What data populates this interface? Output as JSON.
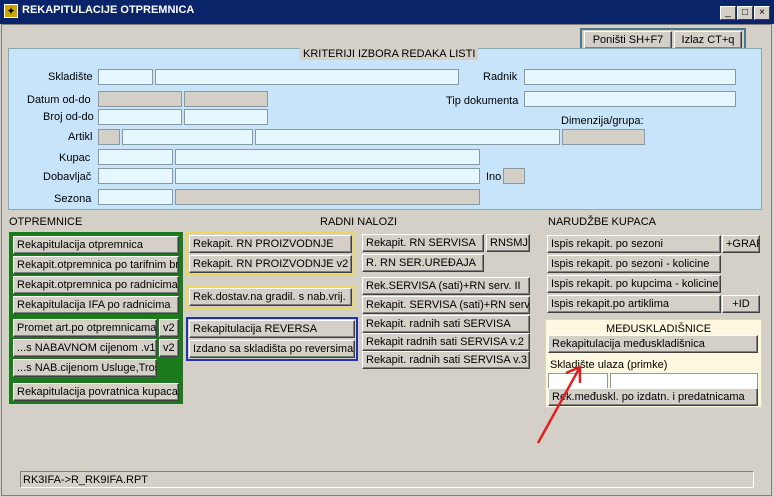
{
  "window": {
    "title": "REKAPITULACIJE OTPREMNICA",
    "app_icon": "app-icon",
    "minimize": "_",
    "maximize": "□",
    "close": "×"
  },
  "toolbar": {
    "cancel": "Poništi SH+F7",
    "exit": "Izlaz CT+q"
  },
  "criteria": {
    "title": "KRITERIJI IZBORA REDAKA LISTI",
    "skladiste": "Skladište",
    "datum": "Datum  od-do",
    "broj": "Broj od-do",
    "artikl": "Artikl",
    "kupac": "Kupac",
    "dobavljac": "Dobavljač",
    "sezona": "Sezona",
    "radnik": "Radnik",
    "tip_dokumenta": "Tip dokumenta",
    "dimenzija": "Dimenzija/grupa:",
    "ino": "Ino"
  },
  "otpremnice": {
    "title": "OTPREMNICE",
    "b1": "Rekapitulacija otpremnica",
    "b2": "Rekapit.otpremnica po tarifnim br.",
    "b3": "Rekapit.otpremnica po radnicima",
    "b4": "Rekapitulacija IFA po radnicima",
    "b5": "Promet art.po otpremnicama",
    "b5v": "v2",
    "b6": "...s NABAVNOM cijenom .v1",
    "b6v": "v2",
    "b7": "...s NAB.cijenom Usluge,Troš",
    "b8": "Rekapitulacija povratnica kupaca"
  },
  "radni_nalozi": {
    "title": "RADNI NALOZI",
    "p1": "Rekapit. RN PROIZVODNJE",
    "p2": "Rekapit. RN PROIZVODNJE v2",
    "p3": "Rek.dostav.na gradil. s nab.vrij.",
    "r1": "Rekapitulacija REVERSA",
    "r2": "Izdano sa skladišta po reversima",
    "s1": "Rekapit. RN SERVISA",
    "s1b": "RNSMJ",
    "s2": "R. RN SER.UREĐAJA",
    "s3": "Rek.SERVISA (sati)+RN serv. II",
    "s4": "Rekapit. SERVISA (sati)+RN serv",
    "s5": "Rekapit. radnih sati SERVISA",
    "s6": "Rekapit radnih sati SERVISA v.2",
    "s7": "Rekapit. radnih sati SERVISA v.3"
  },
  "narudzbe": {
    "title": "NARUDŽBE KUPACA",
    "n1": "Ispis rekapit. po sezoni",
    "n1b": "+GRAF",
    "n2": "Ispis rekapit. po sezoni - kolicine",
    "n3": "Ispis rekapit. po kupcima - kolicine",
    "n4": "Ispis rekapit.po artiklima",
    "n4b": "+ID"
  },
  "meduskladisnice": {
    "title": "MEĐUSKLADIŠNICE",
    "m1": "Rekapitulacija međuskladišnica",
    "label": "Skladište ulaza (primke)",
    "m2": "Rek.međuskl. po izdatn. i predatnicama"
  },
  "status": {
    "text": "RK3IFA->R_RK9IFA.RPT"
  },
  "colors": {
    "titlebar": "#0a246a",
    "criteria_bg": "#c8e4fa",
    "green_group": "#1b7a1b",
    "yellow_group": "#e8d860",
    "blue_group": "#2233aa",
    "arrow": "#e02020"
  }
}
